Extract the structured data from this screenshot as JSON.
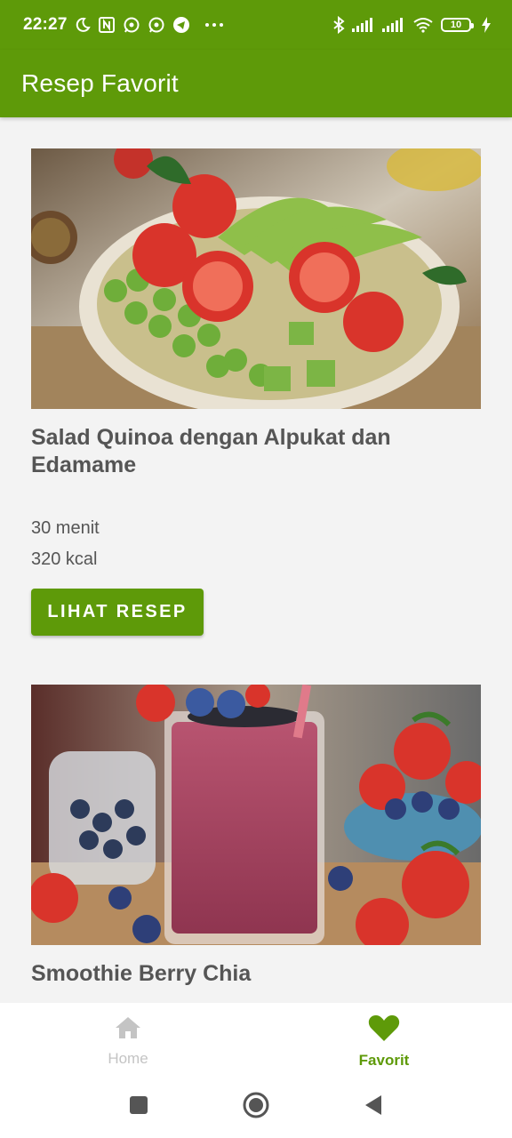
{
  "status_bar": {
    "time": "22:27",
    "battery_level": "10",
    "left_icons": [
      "moon-icon",
      "nfc-icon",
      "whatsapp-icon",
      "whatsapp-business-icon",
      "telegram-icon",
      "more-dots-icon"
    ],
    "right_icons": [
      "bluetooth-icon",
      "signal-icon",
      "signal-icon",
      "wifi-icon",
      "battery-icon",
      "charging-icon"
    ]
  },
  "app_bar": {
    "title": "Resep Favorit"
  },
  "recipes": [
    {
      "title": "Salad Quinoa dengan Alpukat dan Edamame",
      "time": "30 menit",
      "calories": "320 kcal",
      "button_label": "LIHAT RESEP"
    },
    {
      "title": "Smoothie Berry Chia"
    }
  ],
  "bottom_nav": {
    "items": [
      {
        "label": "Home",
        "icon": "home-icon",
        "selected": false
      },
      {
        "label": "Favorit",
        "icon": "heart-icon",
        "selected": true
      }
    ]
  },
  "system_nav": {
    "buttons": [
      "recents-button",
      "home-button",
      "back-button"
    ]
  },
  "colors": {
    "primary": "#5e9a09",
    "background": "#f3f3f3",
    "text": "#555555",
    "inactive": "#c4c4c4"
  }
}
